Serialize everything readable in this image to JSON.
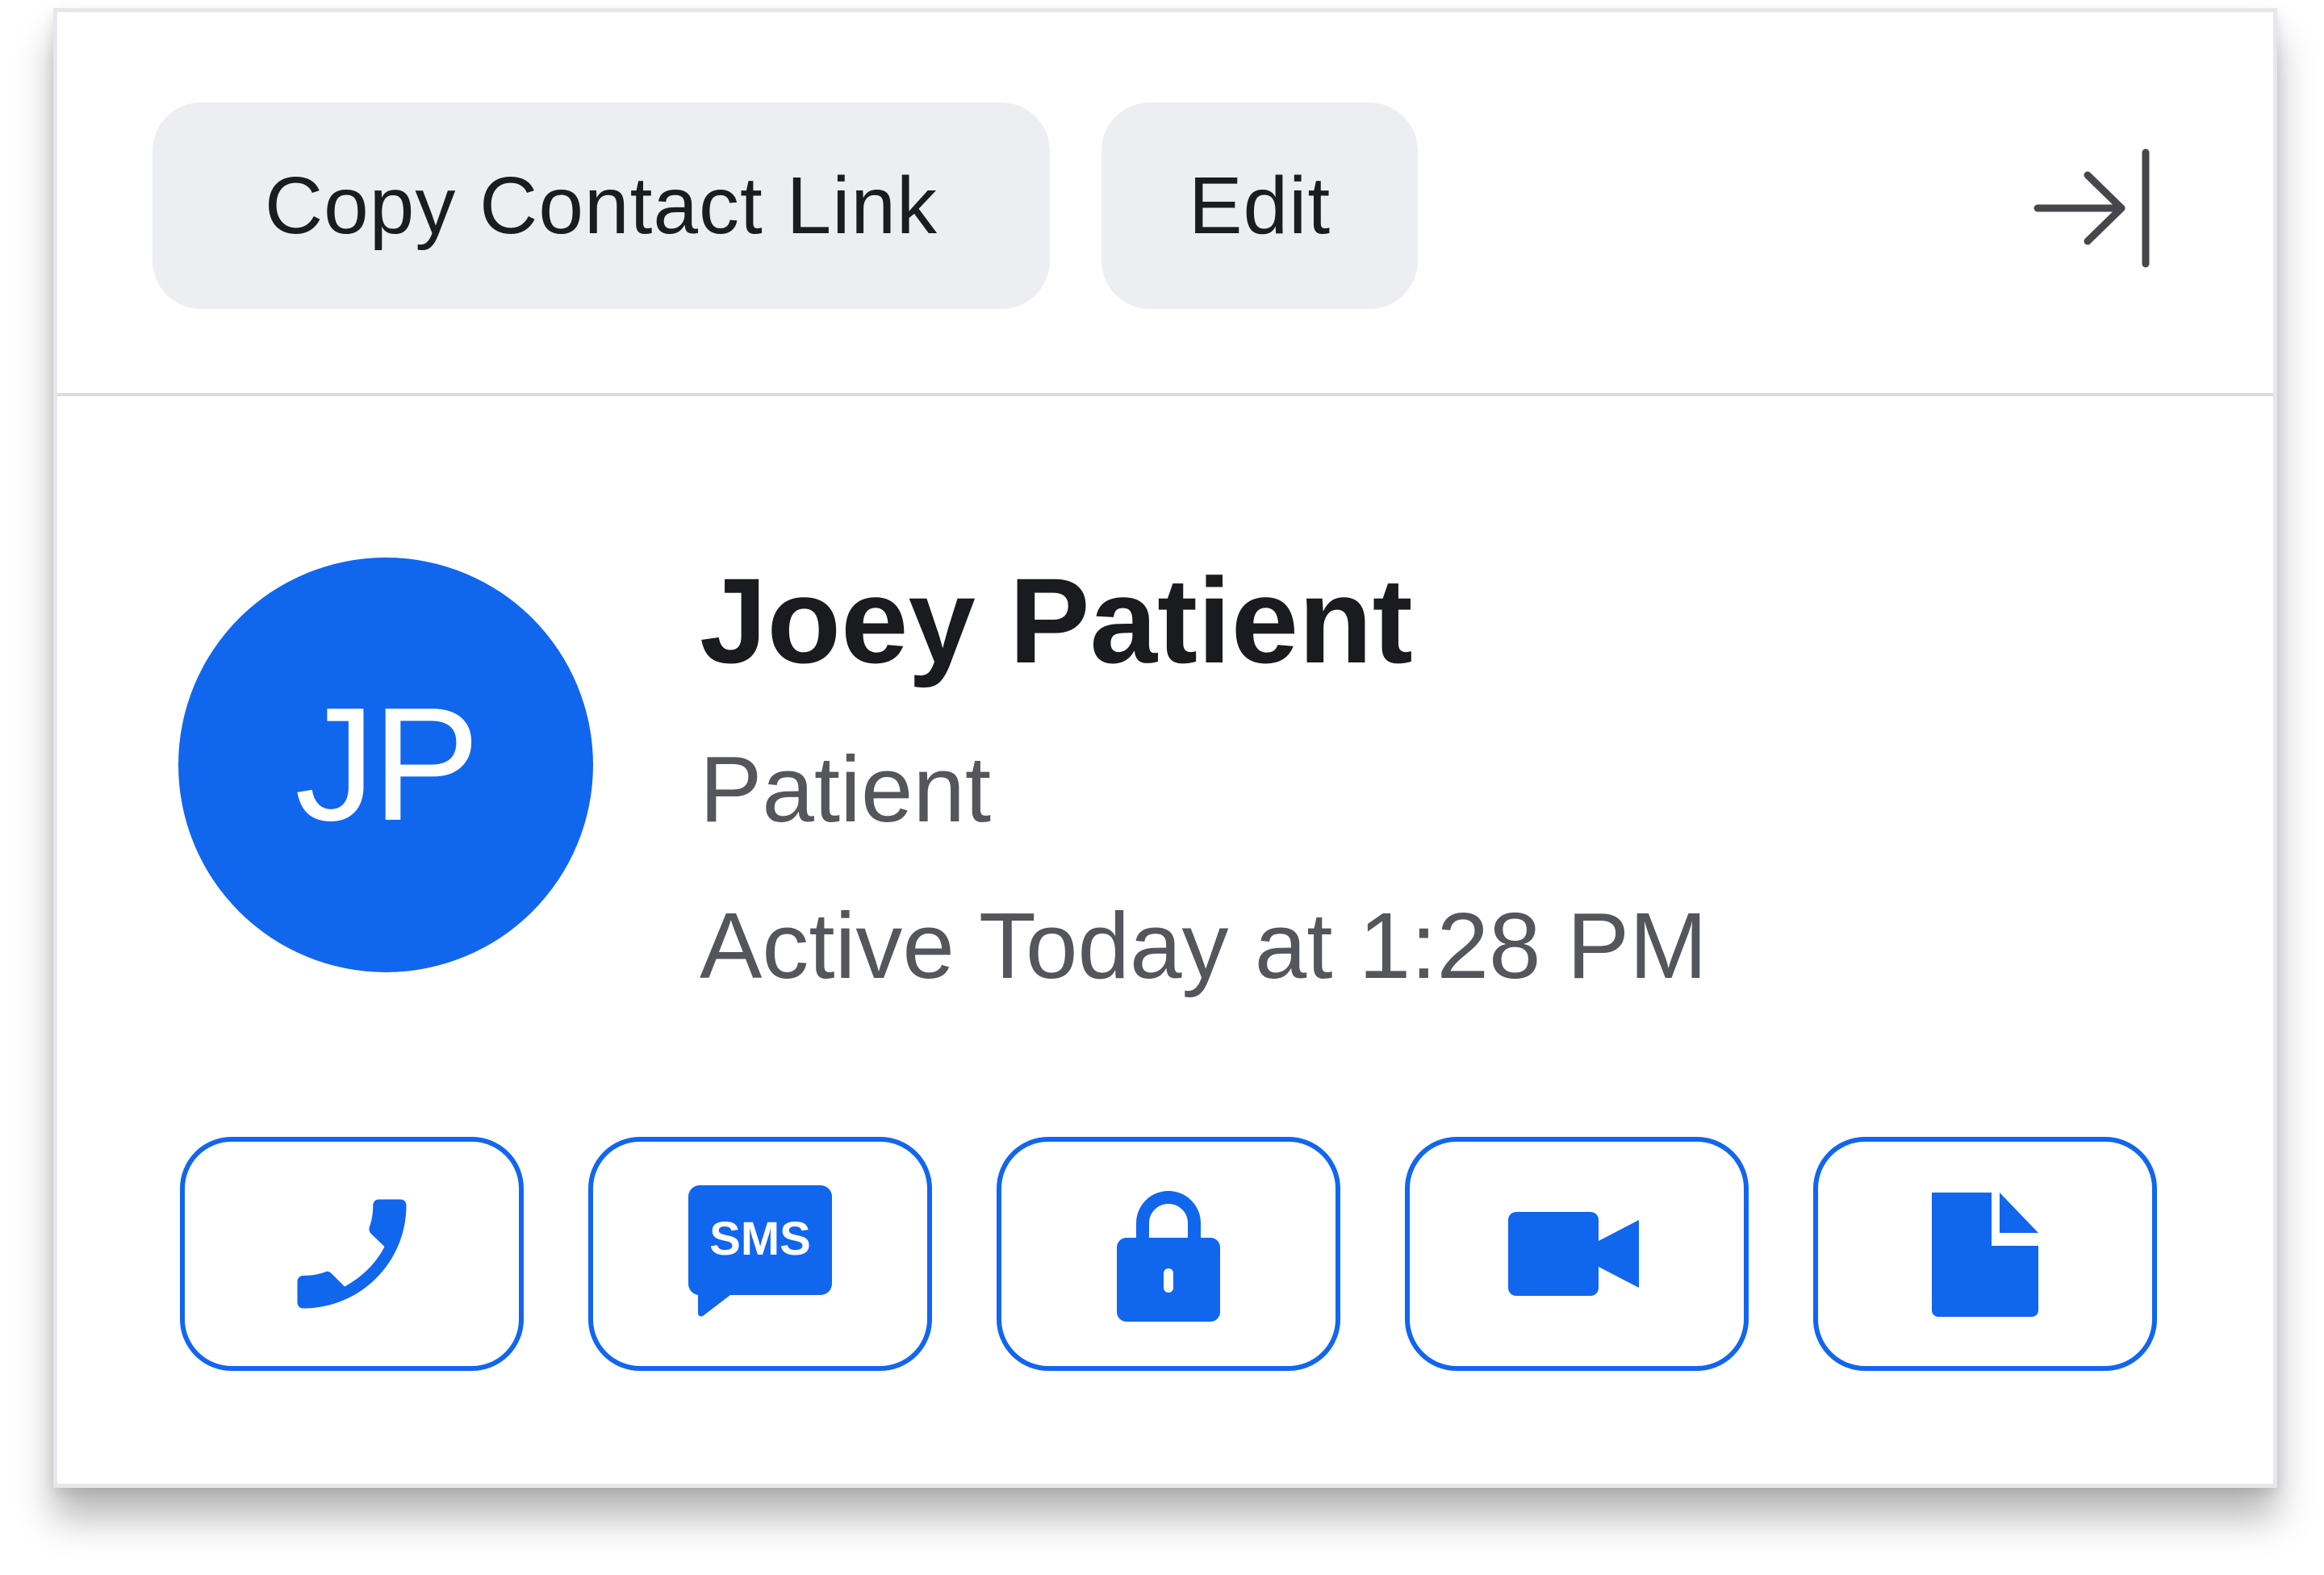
{
  "header": {
    "copy_link_label": "Copy Contact Link",
    "edit_label": "Edit",
    "collapse_icon": "collapse-panel-icon"
  },
  "contact": {
    "initials": "JP",
    "name": "Joey Patient",
    "role": "Patient",
    "activity": "Active Today at 1:28 PM"
  },
  "actions": [
    {
      "icon": "phone-icon"
    },
    {
      "icon": "sms-icon",
      "badge_text": "SMS"
    },
    {
      "icon": "lock-icon"
    },
    {
      "icon": "video-camera-icon"
    },
    {
      "icon": "document-icon"
    }
  ],
  "colors": {
    "accent": "#1166ee",
    "pill_bg": "#edeef1",
    "text_primary": "#1a1b1e",
    "text_secondary": "#54565c",
    "divider": "#dcdde0"
  }
}
